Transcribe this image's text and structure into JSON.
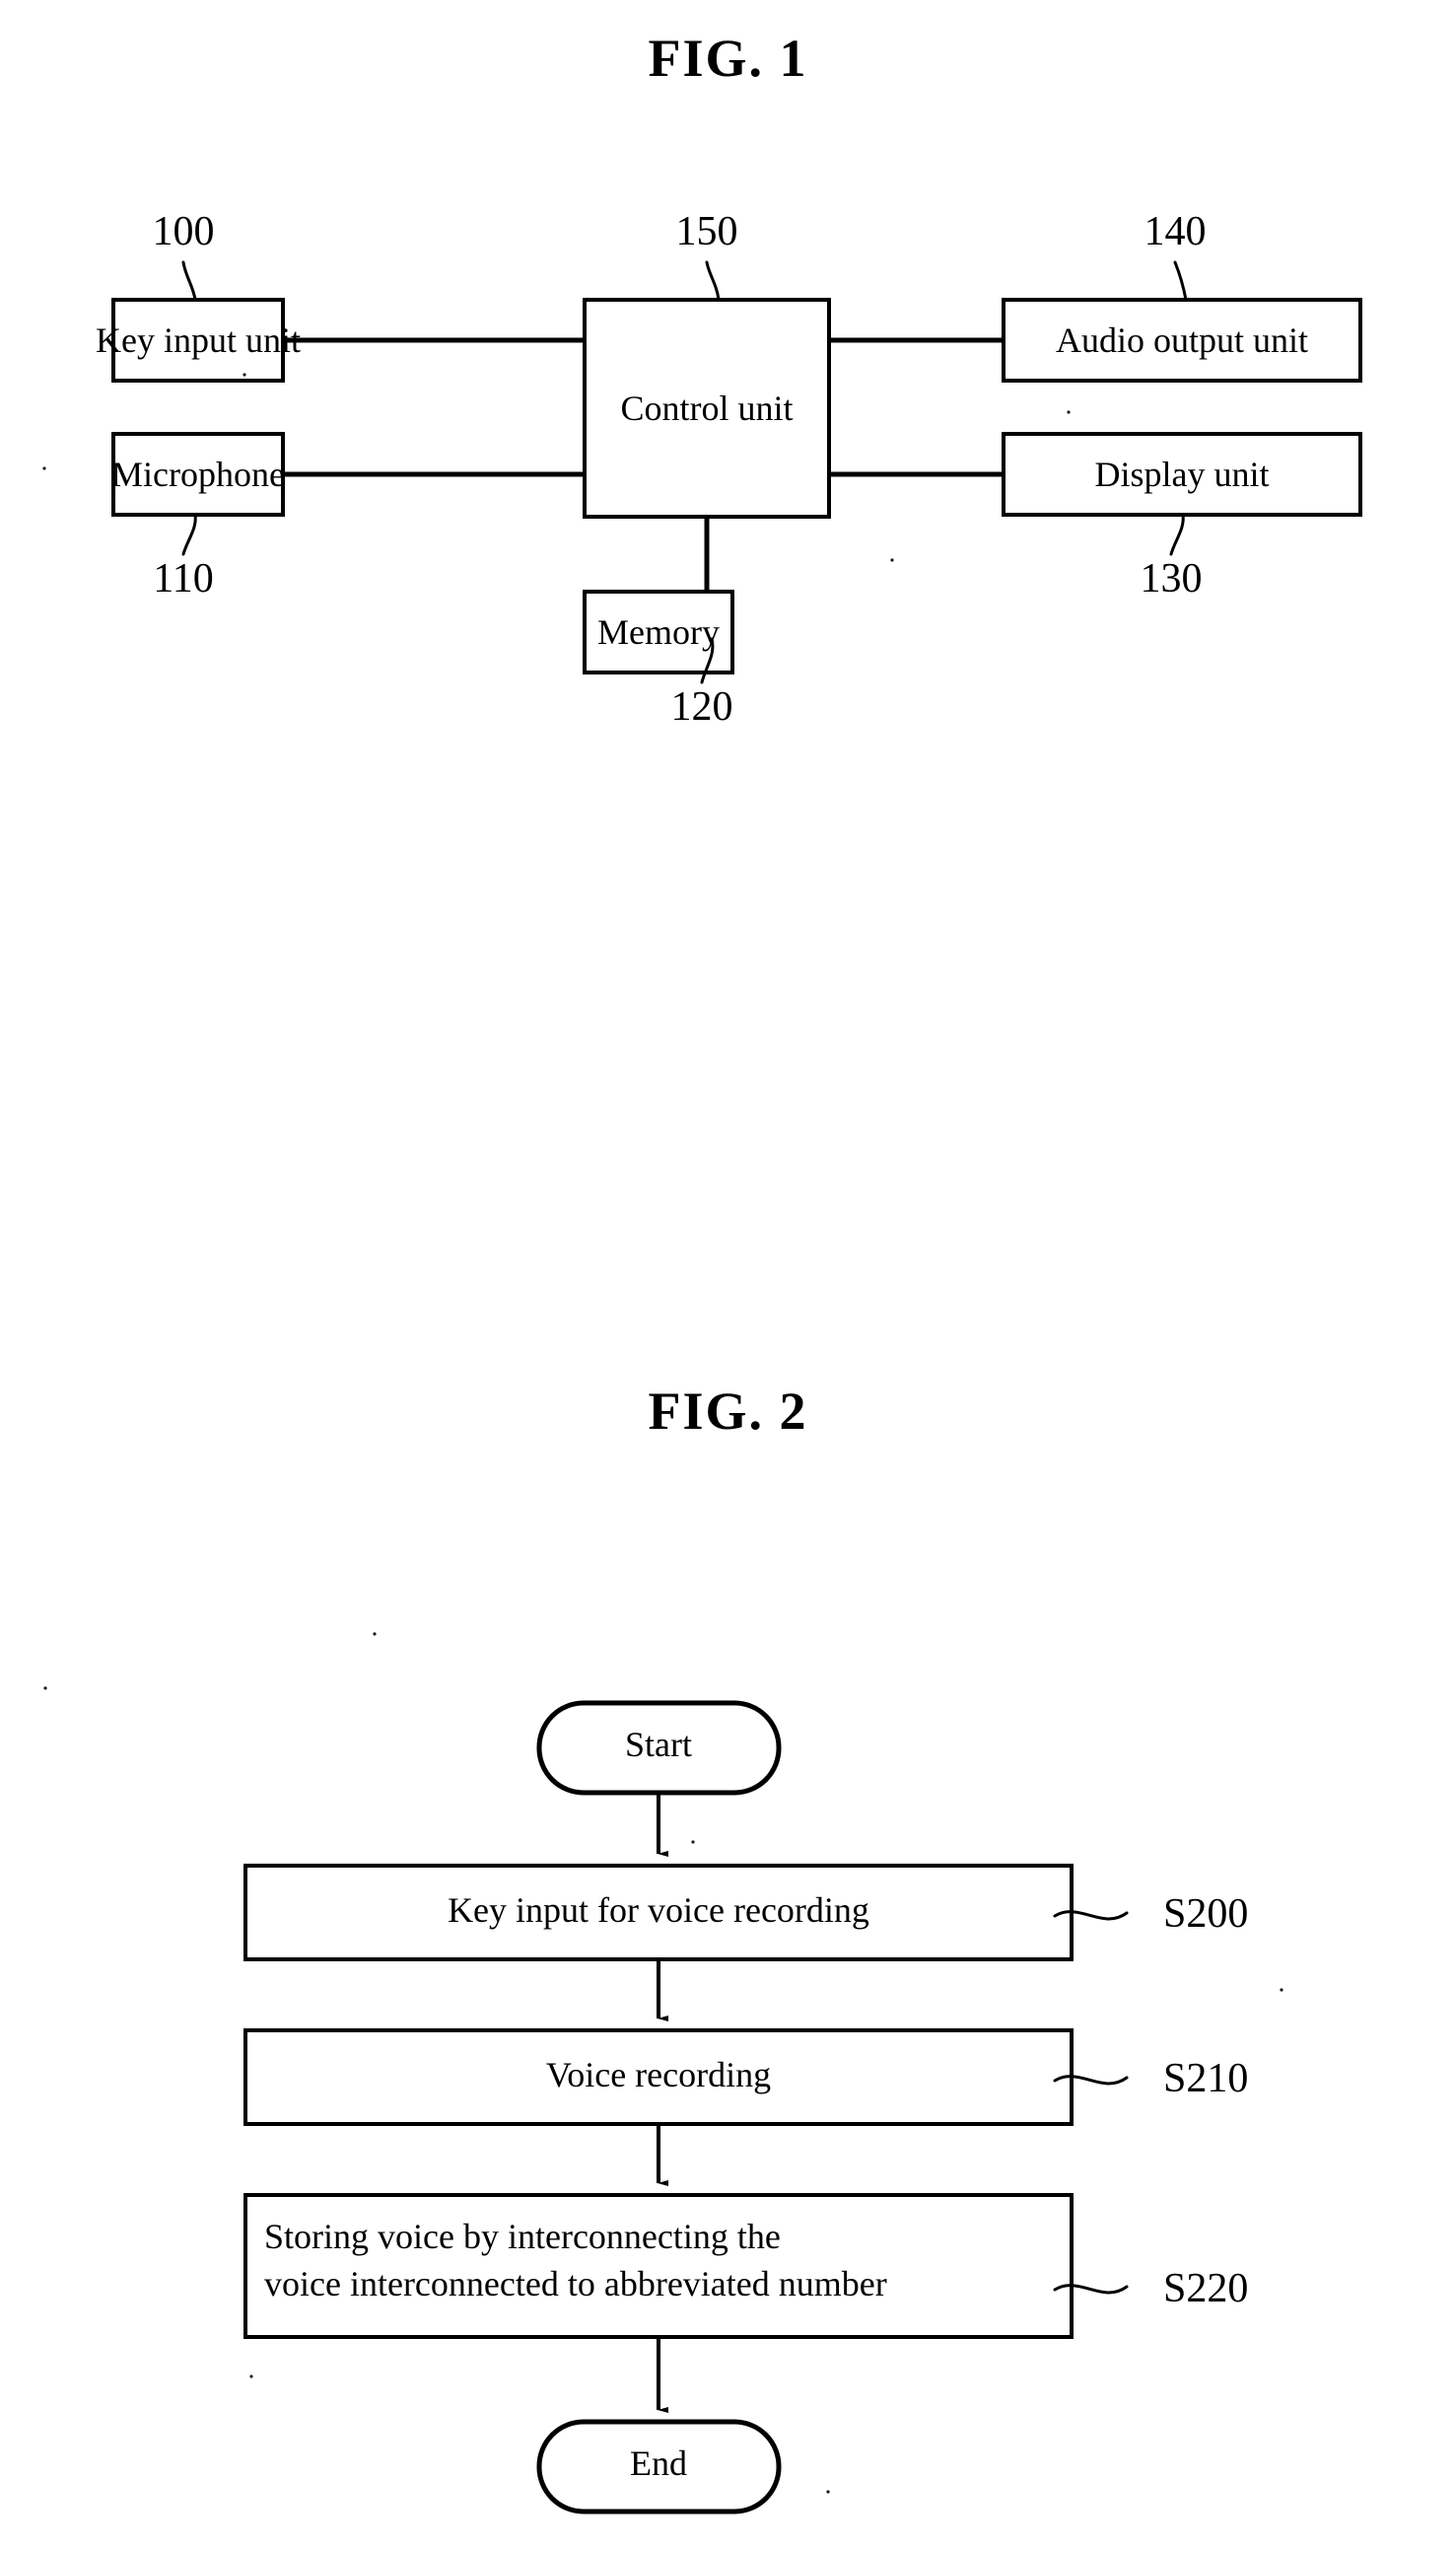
{
  "figures": [
    {
      "title": "FIG. 1",
      "type": "block-diagram",
      "blocks": [
        {
          "label": "Key input unit",
          "ref": "100"
        },
        {
          "label": "Microphone",
          "ref": "110"
        },
        {
          "label": "Memory",
          "ref": "120"
        },
        {
          "label": "Display unit",
          "ref": "130"
        },
        {
          "label": "Audio output unit",
          "ref": "140"
        },
        {
          "label": "Control unit",
          "ref": "150"
        }
      ],
      "connections": [
        {
          "from": "Key input unit",
          "to": "Control unit"
        },
        {
          "from": "Microphone",
          "to": "Control unit"
        },
        {
          "from": "Control unit",
          "to": "Audio output unit"
        },
        {
          "from": "Control unit",
          "to": "Display unit"
        },
        {
          "from": "Control unit",
          "to": "Memory"
        }
      ]
    },
    {
      "title": "FIG. 2",
      "type": "flowchart",
      "start_label": "Start",
      "end_label": "End",
      "steps": [
        {
          "label_line1": "Key input for voice recording",
          "label_line2": "",
          "ref": "S200"
        },
        {
          "label_line1": "Voice recording",
          "label_line2": "",
          "ref": "S210"
        },
        {
          "label_line1": "Storing voice by interconnecting the",
          "label_line2": "voice interconnected to abbreviated number",
          "ref": "S220"
        }
      ]
    }
  ],
  "colors": {
    "ink": "#000000",
    "paper": "#ffffff"
  }
}
